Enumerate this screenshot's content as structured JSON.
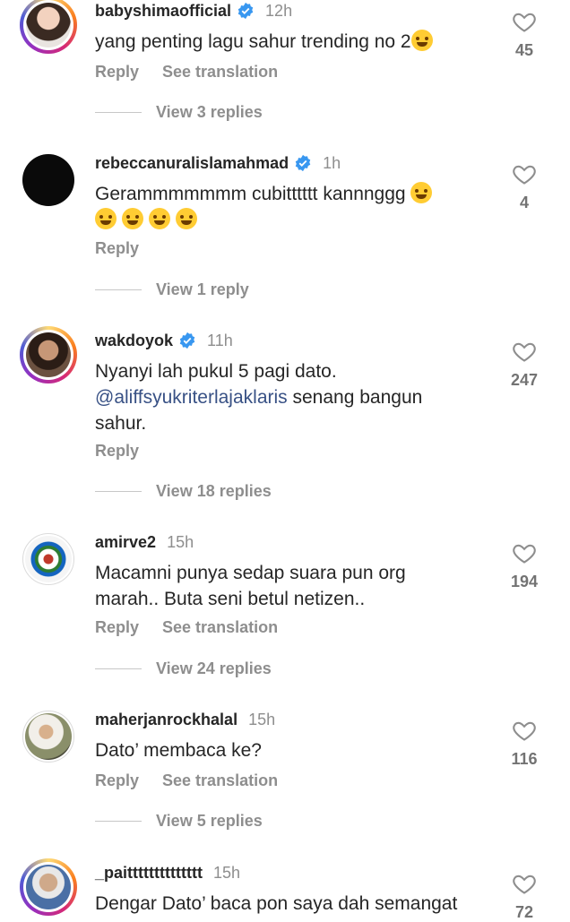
{
  "labels": {
    "reply": "Reply",
    "see_translation": "See translation"
  },
  "comments": [
    {
      "username": "babyshimaofficial",
      "verified": true,
      "time": "12h",
      "line1": "yang penting lagu sahur trending no 2",
      "line2": "",
      "likes": "45",
      "view_replies": "View 3 replies"
    },
    {
      "username": "rebeccanuralislamahmad",
      "verified": true,
      "time": "1h",
      "line1": "Gerammmmmmm cubitttttt kannnggg",
      "line2": "",
      "likes": "4",
      "view_replies": "View 1 reply"
    },
    {
      "username": "wakdoyok",
      "verified": true,
      "time": "11h",
      "line1": "Nyanyi lah pukul 5 pagi dato.",
      "mention": "@aliffsyukriterlajaklaris",
      "line2_rest": " senang bangun",
      "line3": "sahur.",
      "likes": "247",
      "view_replies": "View 18 replies"
    },
    {
      "username": "amirve2",
      "verified": false,
      "time": "15h",
      "line1": "Macamni punya sedap suara pun org",
      "line2": "marah.. Buta seni betul netizen..",
      "likes": "194",
      "view_replies": "View 24 replies"
    },
    {
      "username": "maherjanrockhalal",
      "verified": false,
      "time": "15h",
      "line1": "Dato’ membaca ke?",
      "line2": "",
      "likes": "116",
      "view_replies": "View 5 replies"
    },
    {
      "username": "_paitttttttttttttt",
      "verified": false,
      "time": "15h",
      "line1": "Dengar Dato’ baca pon saya dah semangat",
      "line2": "",
      "likes": "72"
    }
  ]
}
